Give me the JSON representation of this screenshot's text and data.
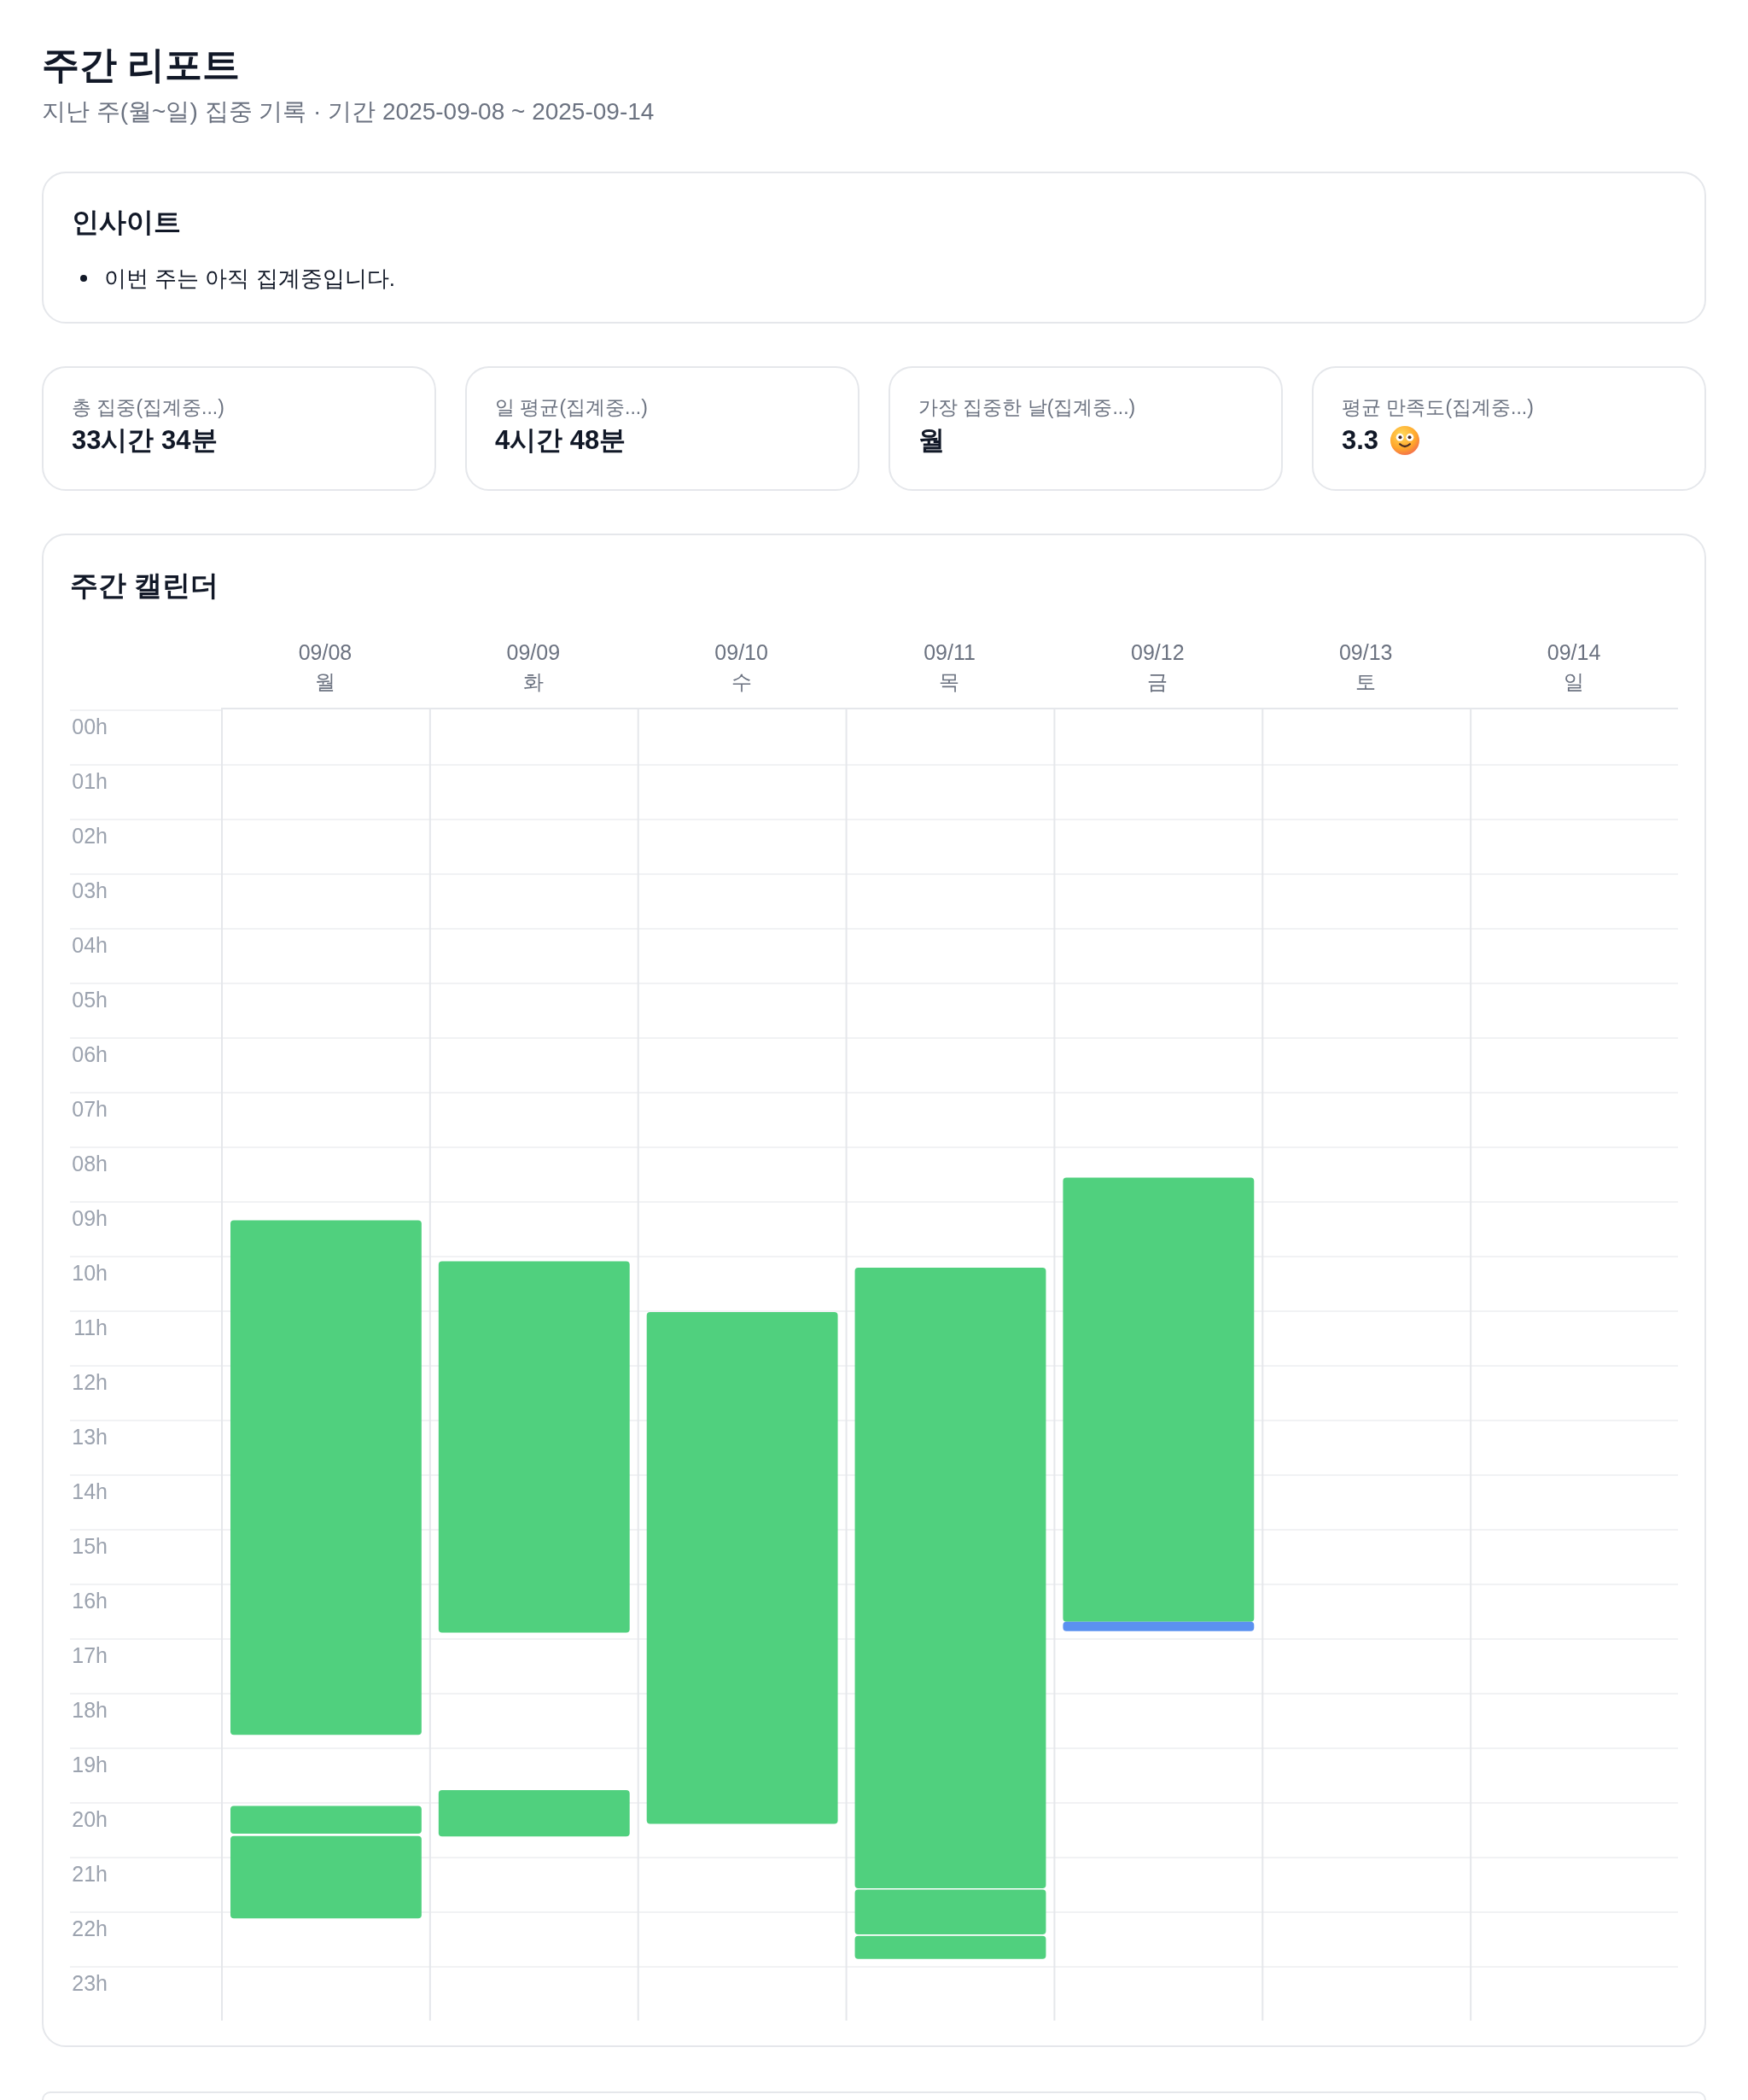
{
  "page": {
    "title": "주간 리포트",
    "subtitle": "지난 주(월~일) 집중 기록 · 기간 2025-09-08 ~ 2025-09-14"
  },
  "insights": {
    "title": "인사이트",
    "items": [
      "이번 주는 아직 집계중입니다."
    ]
  },
  "stats": [
    {
      "kind": "text",
      "label": "총 집중(집계중...)",
      "value": "33시간 34분"
    },
    {
      "kind": "text",
      "label": "일 평균(집계중...)",
      "value": "4시간 48분"
    },
    {
      "kind": "text",
      "label": "가장 집중한 날(집계중...)",
      "value": "월"
    },
    {
      "kind": "rating",
      "label": "평균 만족도(집계중...)",
      "value": "3.3"
    }
  ],
  "calendar": {
    "title": "주간 캘린더",
    "weekdays": [
      "월",
      "화",
      "수",
      "목",
      "금",
      "토",
      "일"
    ],
    "chart_data": {
      "type": "candlestick",
      "grid": true,
      "categories": [
        "09/08",
        "09/09",
        "09/10",
        "09/11",
        "09/12",
        "09/13",
        "09/14"
      ],
      "ylim": [
        24,
        0
      ],
      "yticks": [
        {
          "value": 0,
          "label": "00h"
        },
        {
          "value": 1,
          "label": "01h"
        },
        {
          "value": 2,
          "label": "02h"
        },
        {
          "value": 3,
          "label": "03h"
        },
        {
          "value": 4,
          "label": "04h"
        },
        {
          "value": 5,
          "label": "05h"
        },
        {
          "value": 6,
          "label": "06h"
        },
        {
          "value": 7,
          "label": "07h"
        },
        {
          "value": 8,
          "label": "08h"
        },
        {
          "value": 9,
          "label": "09h"
        },
        {
          "value": 10,
          "label": "10h"
        },
        {
          "value": 11,
          "label": "11h"
        },
        {
          "value": 12,
          "label": "12h"
        },
        {
          "value": 13,
          "label": "13h"
        },
        {
          "value": 14,
          "label": "14h"
        },
        {
          "value": 15,
          "label": "15h"
        },
        {
          "value": 16,
          "label": "16h"
        },
        {
          "value": 17,
          "label": "17h"
        },
        {
          "value": 18,
          "label": "18h"
        },
        {
          "value": 19,
          "label": "19h"
        },
        {
          "value": 20,
          "label": "20h"
        },
        {
          "value": 21,
          "label": "21h"
        },
        {
          "value": 22,
          "label": "22h"
        },
        {
          "value": 23,
          "label": "23h"
        }
      ],
      "series": [
        {
          "color": "#50d07e",
          "ohlc": [
            [
              9.35,
              18.77,
              9.35,
              18.77
            ],
            [
              10.1,
              16.9,
              10.1,
              16.9
            ],
            [
              11.03,
              20.4,
              11.03,
              20.4
            ],
            [
              10.22,
              21.58,
              10.22,
              21.58
            ],
            [
              8.57,
              16.7,
              8.57,
              16.7
            ],
            null,
            null
          ]
        },
        {
          "color": "#50d07e",
          "ohlc": [
            [
              20.07,
              20.58,
              20.07,
              20.58
            ],
            [
              19.78,
              20.63,
              19.78,
              20.63
            ],
            null,
            [
              21.6,
              22.42,
              21.6,
              22.42
            ],
            null,
            null,
            null
          ]
        },
        {
          "color": "#50d07e",
          "ohlc": [
            [
              20.62,
              22.13,
              20.62,
              22.13
            ],
            null,
            null,
            [
              22.45,
              22.87,
              22.45,
              22.87
            ],
            null,
            null,
            null
          ]
        },
        {
          "color": "#5b91f0",
          "ohlc": [
            null,
            null,
            null,
            null,
            [
              16.7,
              16.87,
              16.7,
              16.87
            ],
            null,
            null
          ]
        }
      ]
    }
  }
}
